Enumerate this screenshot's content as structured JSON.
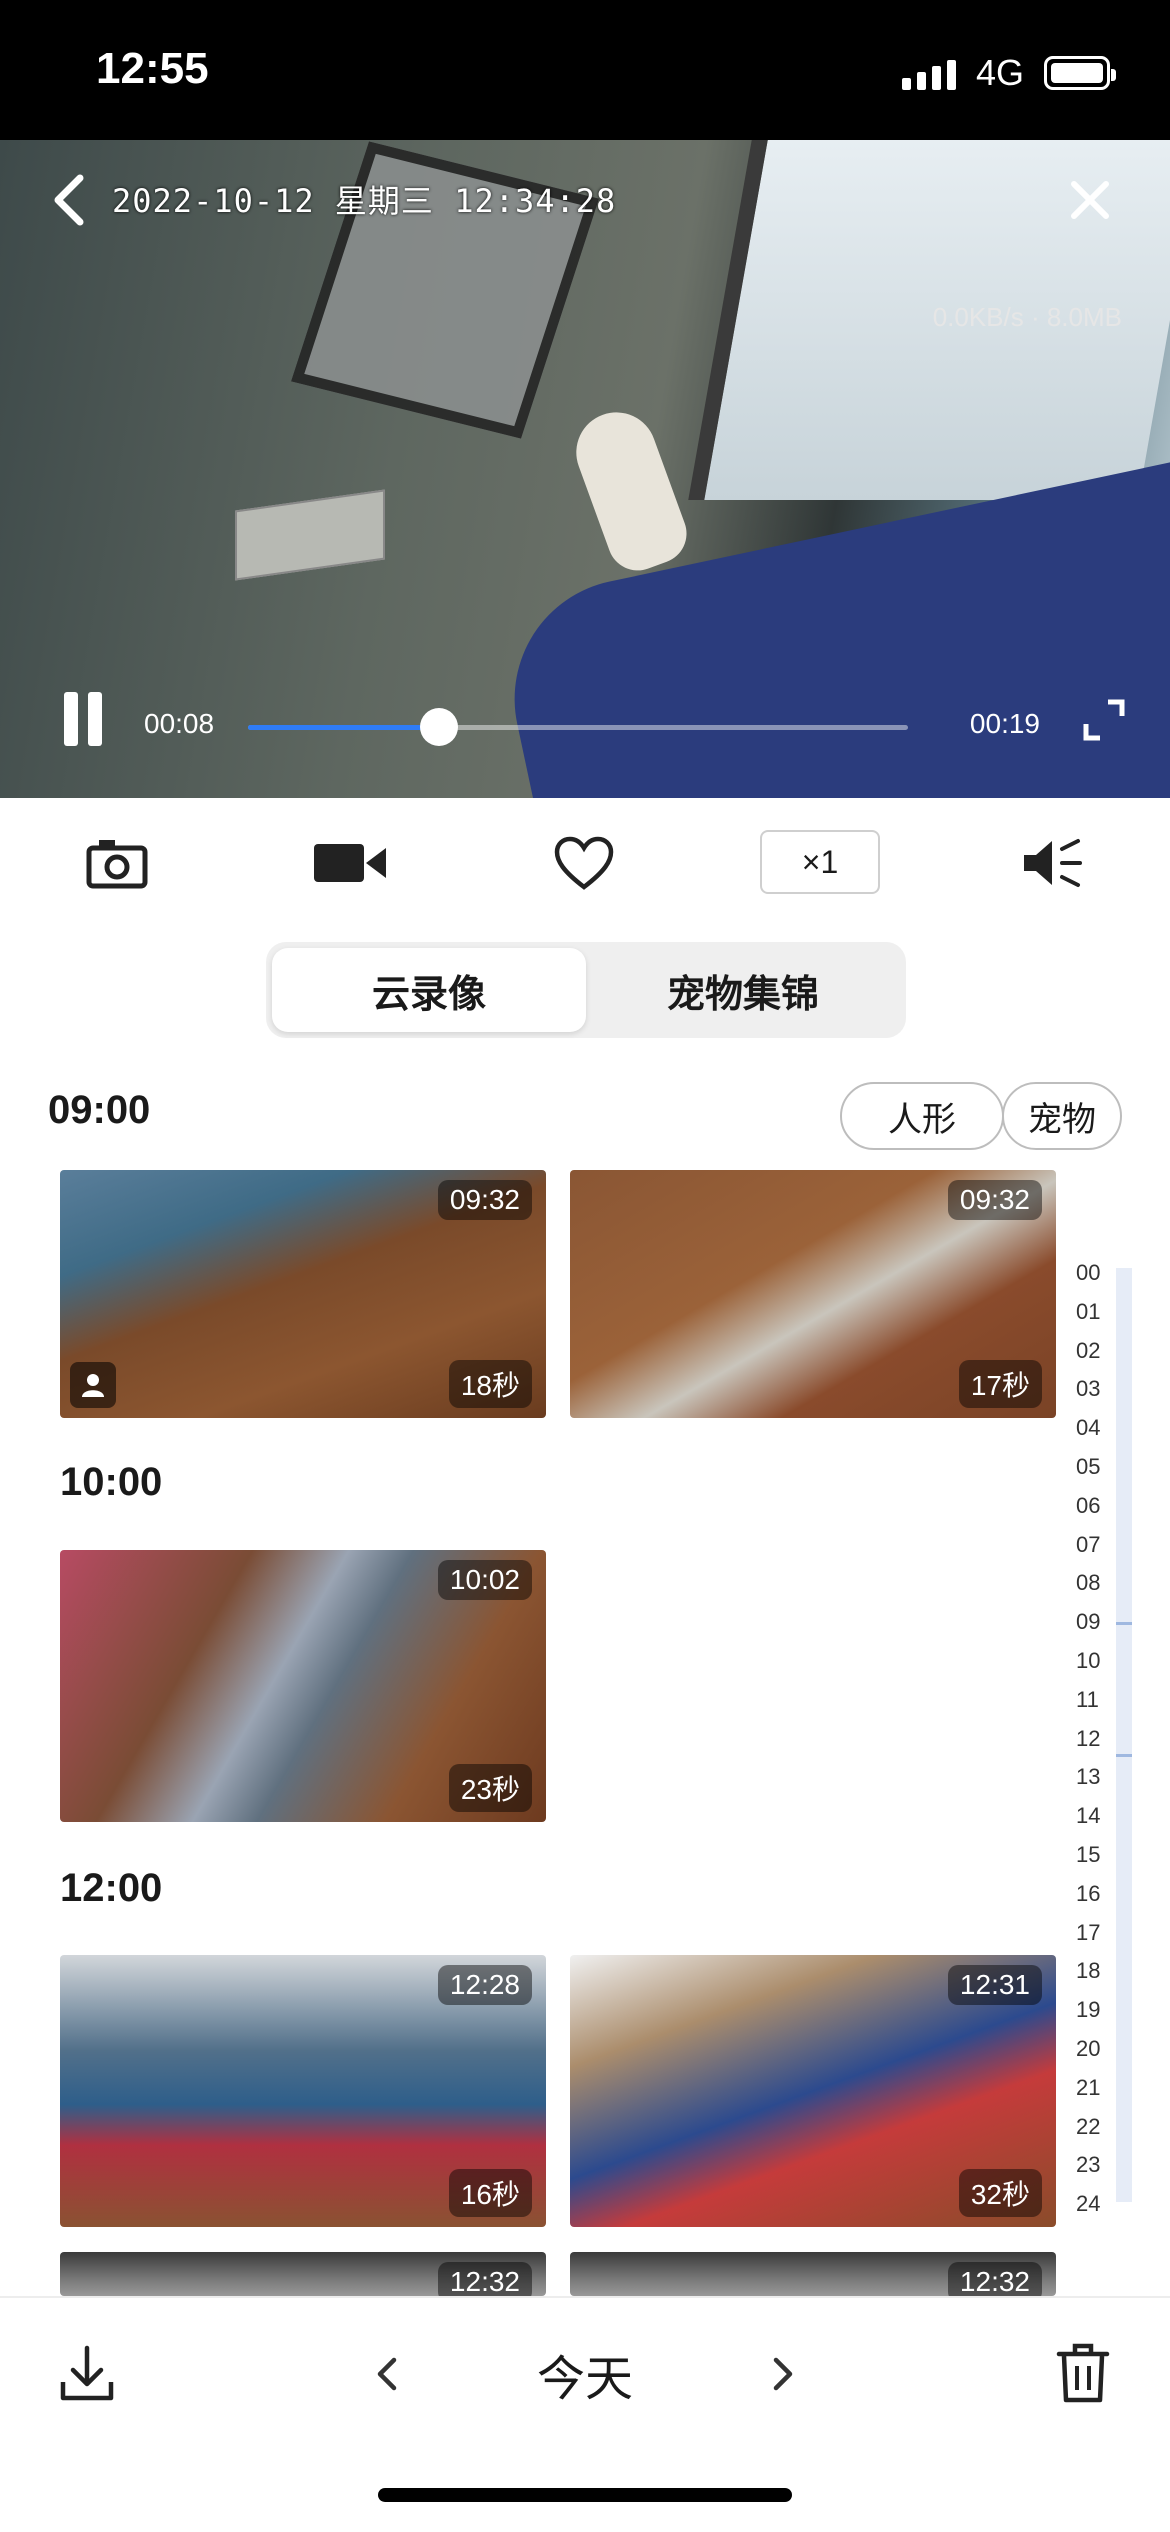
{
  "status_bar": {
    "time": "12:55",
    "network": "4G"
  },
  "player": {
    "datetime_overlay": "2022-10-12 星期三 12:34:28",
    "rate_overlay": "0.0KB/s · 8.0MB",
    "current_time": "00:08",
    "total_time": "00:19",
    "progress": 0.29,
    "accent_color": "#2f7cf6"
  },
  "toolbar": {
    "speed_label": "×1",
    "icons": [
      "camera-icon",
      "video-record-icon",
      "heart-icon",
      "speaker-icon"
    ]
  },
  "tabs": [
    {
      "label": "云录像",
      "active": true
    },
    {
      "label": "宠物集锦",
      "active": false
    }
  ],
  "filters": [
    {
      "label": "人形"
    },
    {
      "label": "宠物"
    }
  ],
  "groups": [
    {
      "hour": "09:00",
      "clips": [
        {
          "time": "09:32",
          "duration": "18秒",
          "person": true
        },
        {
          "time": "09:32",
          "duration": "17秒",
          "person": false
        }
      ]
    },
    {
      "hour": "10:00",
      "clips": [
        {
          "time": "10:02",
          "duration": "23秒",
          "person": false
        }
      ]
    },
    {
      "hour": "12:00",
      "clips": [
        {
          "time": "12:28",
          "duration": "16秒",
          "person": false
        },
        {
          "time": "12:31",
          "duration": "32秒",
          "person": false
        },
        {
          "time": "12:32",
          "duration": "",
          "person": false
        },
        {
          "time": "12:32",
          "duration": "",
          "person": false
        }
      ]
    }
  ],
  "timeline_hours": [
    "00",
    "01",
    "02",
    "03",
    "04",
    "05",
    "06",
    "07",
    "08",
    "09",
    "10",
    "11",
    "12",
    "13",
    "14",
    "15",
    "16",
    "17",
    "18",
    "19",
    "20",
    "21",
    "22",
    "23",
    "24"
  ],
  "bottom_bar": {
    "today_label": "今天"
  }
}
